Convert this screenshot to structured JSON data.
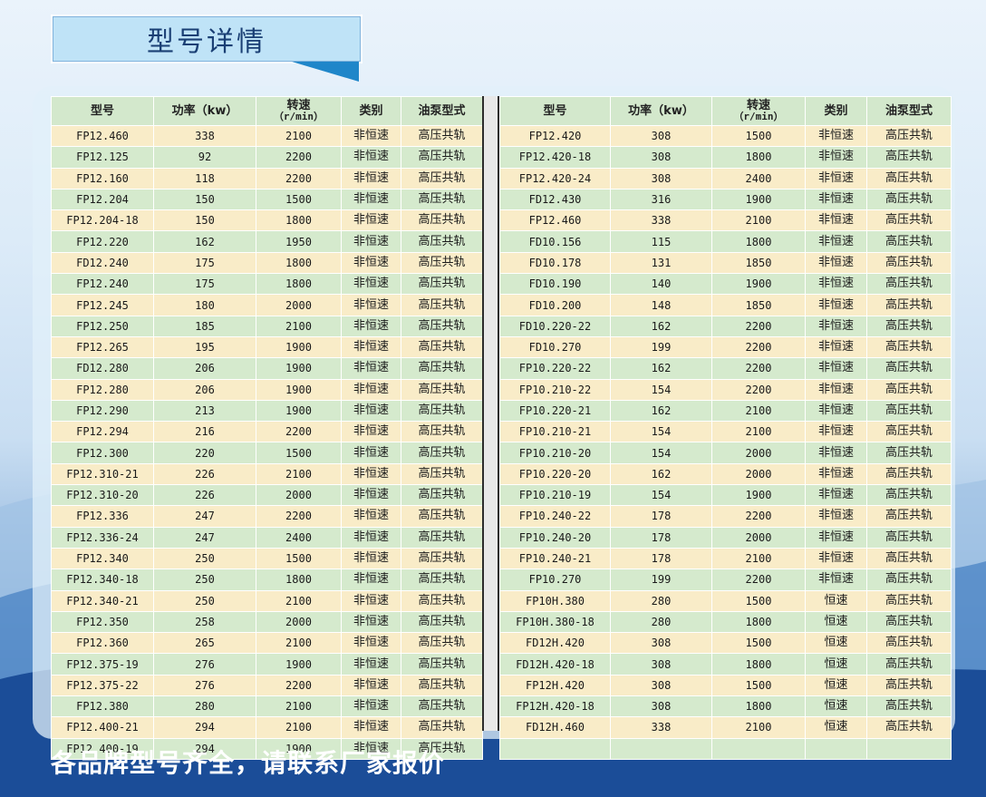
{
  "title": "型号详情",
  "footer": "各品牌型号齐全，请联系厂家报价",
  "headers": {
    "model": "型号",
    "power": "功率（kw）",
    "speed_top": "转速",
    "speed_unit": "（r/min）",
    "type": "类别",
    "pump": "油泵型式"
  },
  "left_rows": [
    [
      "FP12.460",
      "338",
      "2100",
      "非恒速",
      "高压共轨"
    ],
    [
      "FP12.125",
      "92",
      "2200",
      "非恒速",
      "高压共轨"
    ],
    [
      "FP12.160",
      "118",
      "2200",
      "非恒速",
      "高压共轨"
    ],
    [
      "FP12.204",
      "150",
      "1500",
      "非恒速",
      "高压共轨"
    ],
    [
      "FP12.204-18",
      "150",
      "1800",
      "非恒速",
      "高压共轨"
    ],
    [
      "FP12.220",
      "162",
      "1950",
      "非恒速",
      "高压共轨"
    ],
    [
      "FD12.240",
      "175",
      "1800",
      "非恒速",
      "高压共轨"
    ],
    [
      "FP12.240",
      "175",
      "1800",
      "非恒速",
      "高压共轨"
    ],
    [
      "FP12.245",
      "180",
      "2000",
      "非恒速",
      "高压共轨"
    ],
    [
      "FP12.250",
      "185",
      "2100",
      "非恒速",
      "高压共轨"
    ],
    [
      "FP12.265",
      "195",
      "1900",
      "非恒速",
      "高压共轨"
    ],
    [
      "FD12.280",
      "206",
      "1900",
      "非恒速",
      "高压共轨"
    ],
    [
      "FP12.280",
      "206",
      "1900",
      "非恒速",
      "高压共轨"
    ],
    [
      "FP12.290",
      "213",
      "1900",
      "非恒速",
      "高压共轨"
    ],
    [
      "FP12.294",
      "216",
      "2200",
      "非恒速",
      "高压共轨"
    ],
    [
      "FP12.300",
      "220",
      "1500",
      "非恒速",
      "高压共轨"
    ],
    [
      "FP12.310-21",
      "226",
      "2100",
      "非恒速",
      "高压共轨"
    ],
    [
      "FP12.310-20",
      "226",
      "2000",
      "非恒速",
      "高压共轨"
    ],
    [
      "FP12.336",
      "247",
      "2200",
      "非恒速",
      "高压共轨"
    ],
    [
      "FP12.336-24",
      "247",
      "2400",
      "非恒速",
      "高压共轨"
    ],
    [
      "FP12.340",
      "250",
      "1500",
      "非恒速",
      "高压共轨"
    ],
    [
      "FP12.340-18",
      "250",
      "1800",
      "非恒速",
      "高压共轨"
    ],
    [
      "FP12.340-21",
      "250",
      "2100",
      "非恒速",
      "高压共轨"
    ],
    [
      "FP12.350",
      "258",
      "2000",
      "非恒速",
      "高压共轨"
    ],
    [
      "FP12.360",
      "265",
      "2100",
      "非恒速",
      "高压共轨"
    ],
    [
      "FP12.375-19",
      "276",
      "1900",
      "非恒速",
      "高压共轨"
    ],
    [
      "FP12.375-22",
      "276",
      "2200",
      "非恒速",
      "高压共轨"
    ],
    [
      "FP12.380",
      "280",
      "2100",
      "非恒速",
      "高压共轨"
    ],
    [
      "FP12.400-21",
      "294",
      "2100",
      "非恒速",
      "高压共轨"
    ],
    [
      "FP12.400-19",
      "294",
      "1900",
      "非恒速",
      "高压共轨"
    ]
  ],
  "right_rows": [
    [
      "FP12.420",
      "308",
      "1500",
      "非恒速",
      "高压共轨"
    ],
    [
      "FP12.420-18",
      "308",
      "1800",
      "非恒速",
      "高压共轨"
    ],
    [
      "FP12.420-24",
      "308",
      "2400",
      "非恒速",
      "高压共轨"
    ],
    [
      "FD12.430",
      "316",
      "1900",
      "非恒速",
      "高压共轨"
    ],
    [
      "FP12.460",
      "338",
      "2100",
      "非恒速",
      "高压共轨"
    ],
    [
      "FD10.156",
      "115",
      "1800",
      "非恒速",
      "高压共轨"
    ],
    [
      "FD10.178",
      "131",
      "1850",
      "非恒速",
      "高压共轨"
    ],
    [
      "FD10.190",
      "140",
      "1900",
      "非恒速",
      "高压共轨"
    ],
    [
      "FD10.200",
      "148",
      "1850",
      "非恒速",
      "高压共轨"
    ],
    [
      "FD10.220-22",
      "162",
      "2200",
      "非恒速",
      "高压共轨"
    ],
    [
      "FD10.270",
      "199",
      "2200",
      "非恒速",
      "高压共轨"
    ],
    [
      "FP10.220-22",
      "162",
      "2200",
      "非恒速",
      "高压共轨"
    ],
    [
      "FP10.210-22",
      "154",
      "2200",
      "非恒速",
      "高压共轨"
    ],
    [
      "FP10.220-21",
      "162",
      "2100",
      "非恒速",
      "高压共轨"
    ],
    [
      "FP10.210-21",
      "154",
      "2100",
      "非恒速",
      "高压共轨"
    ],
    [
      "FP10.210-20",
      "154",
      "2000",
      "非恒速",
      "高压共轨"
    ],
    [
      "FP10.220-20",
      "162",
      "2000",
      "非恒速",
      "高压共轨"
    ],
    [
      "FP10.210-19",
      "154",
      "1900",
      "非恒速",
      "高压共轨"
    ],
    [
      "FP10.240-22",
      "178",
      "2200",
      "非恒速",
      "高压共轨"
    ],
    [
      "FP10.240-20",
      "178",
      "2000",
      "非恒速",
      "高压共轨"
    ],
    [
      "FP10.240-21",
      "178",
      "2100",
      "非恒速",
      "高压共轨"
    ],
    [
      "FP10.270",
      "199",
      "2200",
      "非恒速",
      "高压共轨"
    ],
    [
      "FP10H.380",
      "280",
      "1500",
      "恒速",
      "高压共轨"
    ],
    [
      "FP10H.380-18",
      "280",
      "1800",
      "恒速",
      "高压共轨"
    ],
    [
      "FD12H.420",
      "308",
      "1500",
      "恒速",
      "高压共轨"
    ],
    [
      "FD12H.420-18",
      "308",
      "1800",
      "恒速",
      "高压共轨"
    ],
    [
      "FP12H.420",
      "308",
      "1500",
      "恒速",
      "高压共轨"
    ],
    [
      "FP12H.420-18",
      "308",
      "1800",
      "恒速",
      "高压共轨"
    ],
    [
      "FD12H.460",
      "338",
      "2100",
      "恒速",
      "高压共轨"
    ],
    [
      "",
      "",
      "",
      "",
      ""
    ]
  ]
}
